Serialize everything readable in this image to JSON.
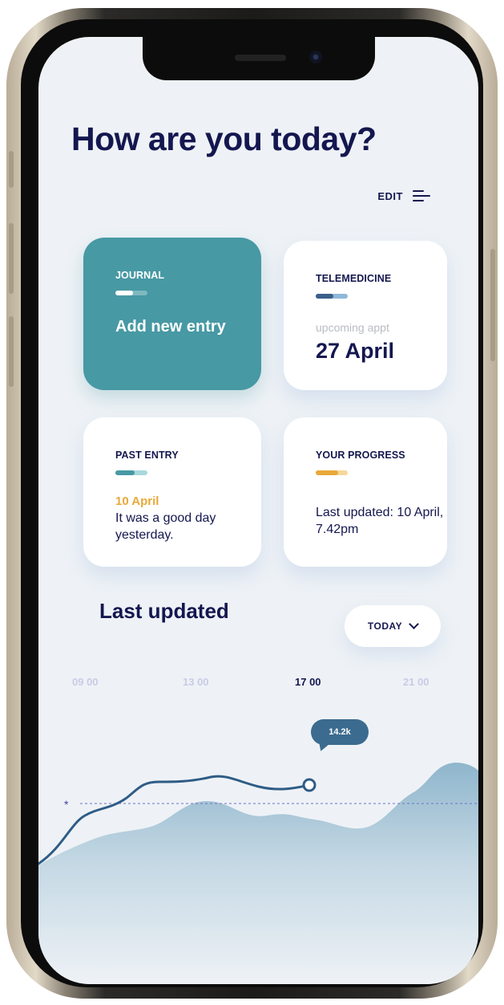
{
  "header": {
    "title": "How are you today?",
    "edit_label": "EDIT",
    "menu_icon": "menu-lines-icon"
  },
  "cards": {
    "journal": {
      "title": "JOURNAL",
      "action": "Add new entry",
      "progress": 0.55,
      "color": "#4799a4"
    },
    "telemedicine": {
      "title": "TELEMEDICINE",
      "sub": "upcoming appt",
      "date": "27 April",
      "progress": 0.55
    },
    "past_entry": {
      "title": "PAST ENTRY",
      "date": "10 April",
      "text": "It was a good day yesterday.",
      "progress": 0.55
    },
    "progress": {
      "title": "YOUR PROGRESS",
      "text": "Last updated: 10 April, 7.42pm",
      "progress": 0.65
    }
  },
  "activity": {
    "title": "Last updated",
    "range_label": "TODAY",
    "times": [
      "09 00",
      "13 00",
      "17 00",
      "21 00"
    ],
    "active_time": "17 00",
    "marker_value": "14.2k",
    "goal_marker": "*"
  },
  "colors": {
    "navy": "#14174f",
    "teal": "#4799a4",
    "amber": "#e8a93a",
    "background": "#eef2f6"
  }
}
